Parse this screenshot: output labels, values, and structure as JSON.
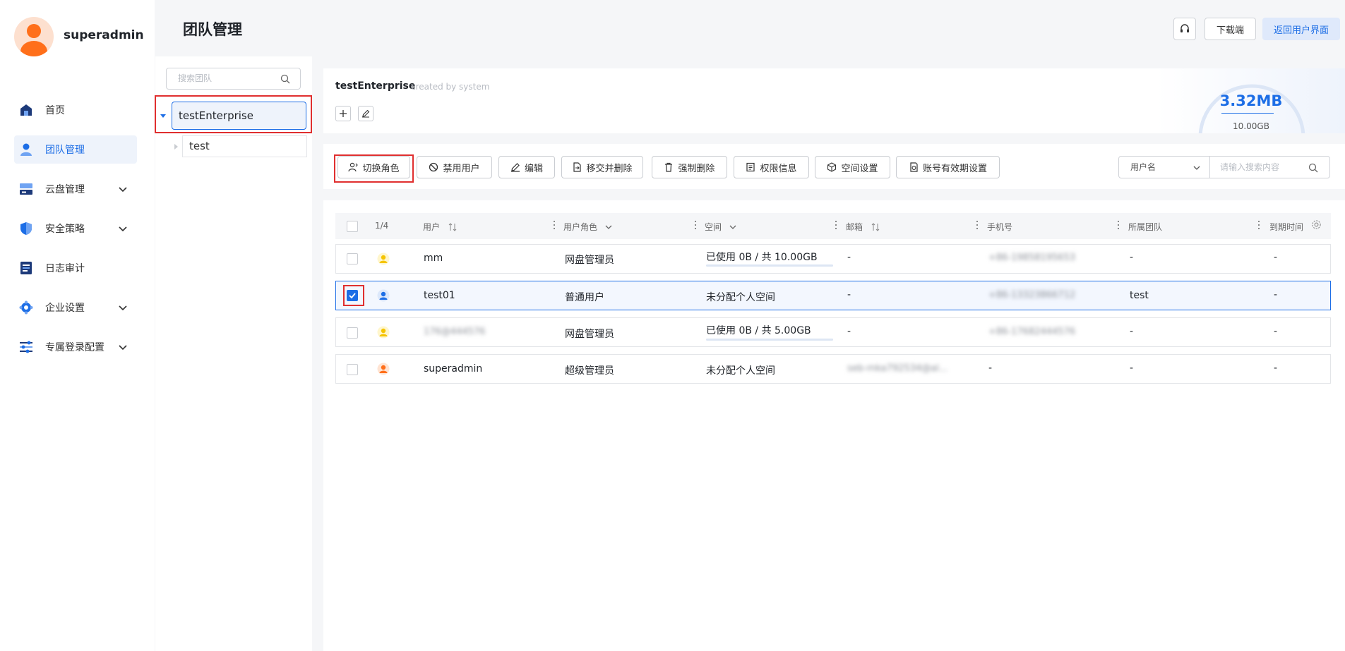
{
  "sidebar": {
    "username": "superadmin",
    "items": [
      {
        "label": "首页",
        "icon": "home-icon"
      },
      {
        "label": "团队管理",
        "icon": "team-icon"
      },
      {
        "label": "云盘管理",
        "icon": "cloud-disk-icon"
      },
      {
        "label": "安全策略",
        "icon": "shield-icon"
      },
      {
        "label": "日志审计",
        "icon": "log-icon"
      },
      {
        "label": "企业设置",
        "icon": "settings-icon"
      },
      {
        "label": "专属登录配置",
        "icon": "login-config-icon"
      }
    ]
  },
  "header": {
    "title": "团队管理",
    "download_label": "下载端",
    "back_label": "返回用户界面"
  },
  "team_panel": {
    "search_placeholder": "搜索团队",
    "tree": [
      {
        "label": "testEnterprise",
        "expanded": true
      },
      {
        "label": "test"
      }
    ]
  },
  "enterprise": {
    "name": "testEnterprise",
    "subtitle": "created by system",
    "used": "3.32MB",
    "total": "10.00GB"
  },
  "toolbar": {
    "buttons": [
      "切换角色",
      "禁用用户",
      "编辑",
      "移交并删除",
      "强制删除",
      "权限信息",
      "空间设置",
      "账号有效期设置"
    ],
    "filter_select": "用户名",
    "search_placeholder": "请输入搜索内容"
  },
  "table": {
    "selection_count": "1/4",
    "columns": [
      "用户",
      "用户角色",
      "空间",
      "邮箱",
      "手机号",
      "所属团队",
      "到期时间"
    ],
    "rows": [
      {
        "name": "mm",
        "role": "网盘管理员",
        "space": "已使用 0B / 共 10.00GB",
        "email": "-",
        "phone": "+86-19858195653",
        "team": "-",
        "expire": "-",
        "checked": false,
        "avatar_color": "#f5c400"
      },
      {
        "name": "test01",
        "role": "普通用户",
        "space": "未分配个人空间",
        "email": "-",
        "phone": "+86-13323866712",
        "team": "test",
        "expire": "-",
        "checked": true,
        "avatar_color": "#1d6ee6"
      },
      {
        "name": "176@444576",
        "role": "网盘管理员",
        "space": "已使用 0B / 共 5.00GB",
        "email": "-",
        "phone": "+86-17682444576",
        "team": "-",
        "expire": "-",
        "checked": false,
        "avatar_color": "#f5c400"
      },
      {
        "name": "superadmin",
        "role": "超级管理员",
        "space": "未分配个人空间",
        "email": "seb-mka792534@al...",
        "phone": "-",
        "team": "-",
        "expire": "-",
        "checked": false,
        "avatar_color": "#ff6f1a"
      }
    ]
  },
  "colors": {
    "accent": "#1d6ee6",
    "highlight": "#e02f2f"
  }
}
